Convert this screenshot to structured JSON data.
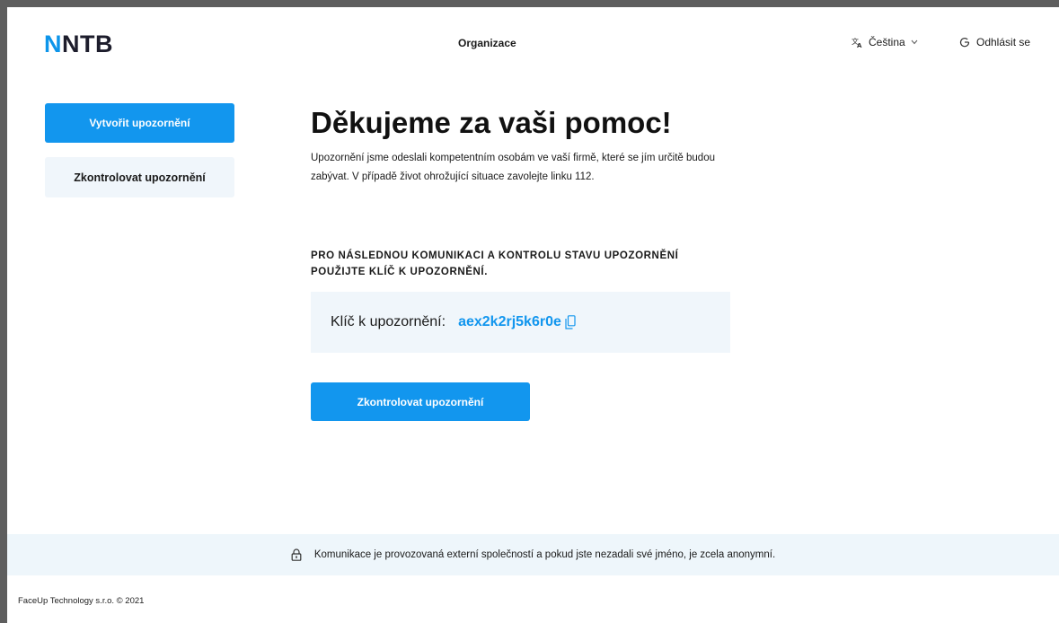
{
  "header": {
    "logo_first": "N",
    "logo_rest": "NTB",
    "organization": "Organizace",
    "language": "Čeština",
    "logout": "Odhlásit se"
  },
  "sidebar": {
    "items": [
      {
        "label": "Vytvořit upozornění",
        "active": true
      },
      {
        "label": "Zkontrolovat upozornění",
        "active": false
      }
    ]
  },
  "main": {
    "title": "Děkujeme za vaši pomoc!",
    "description": "Upozornění jsme odeslali kompetentním osobám ve vaší firmě, které se jím určitě budou zabývat. V případě život ohrožující situace zavolejte linku 112.",
    "instruction": "PRO NÁSLEDNOU KOMUNIKACI A KONTROLU STAVU UPOZORNĚNÍ POUŽIJTE KLÍČ K UPOZORNĚNÍ.",
    "key_label": "Klíč k upozornění:",
    "key_value": "aex2k2rj5k6r0e",
    "check_button": "Zkontrolovat upozornění"
  },
  "footer": {
    "notice": "Komunikace je provozovaná externí společností a pokud jste nezadali své jméno, je zcela anonymní.",
    "copyright": "FaceUp Technology s.r.o. © 2021"
  },
  "colors": {
    "accent": "#1296ee",
    "light_panel": "#f0f6fb",
    "logo_dark": "#1d1d2c"
  },
  "icons": [
    "translate-icon",
    "chevron-down-icon",
    "logout-icon",
    "copy-icon",
    "lock-icon"
  ]
}
